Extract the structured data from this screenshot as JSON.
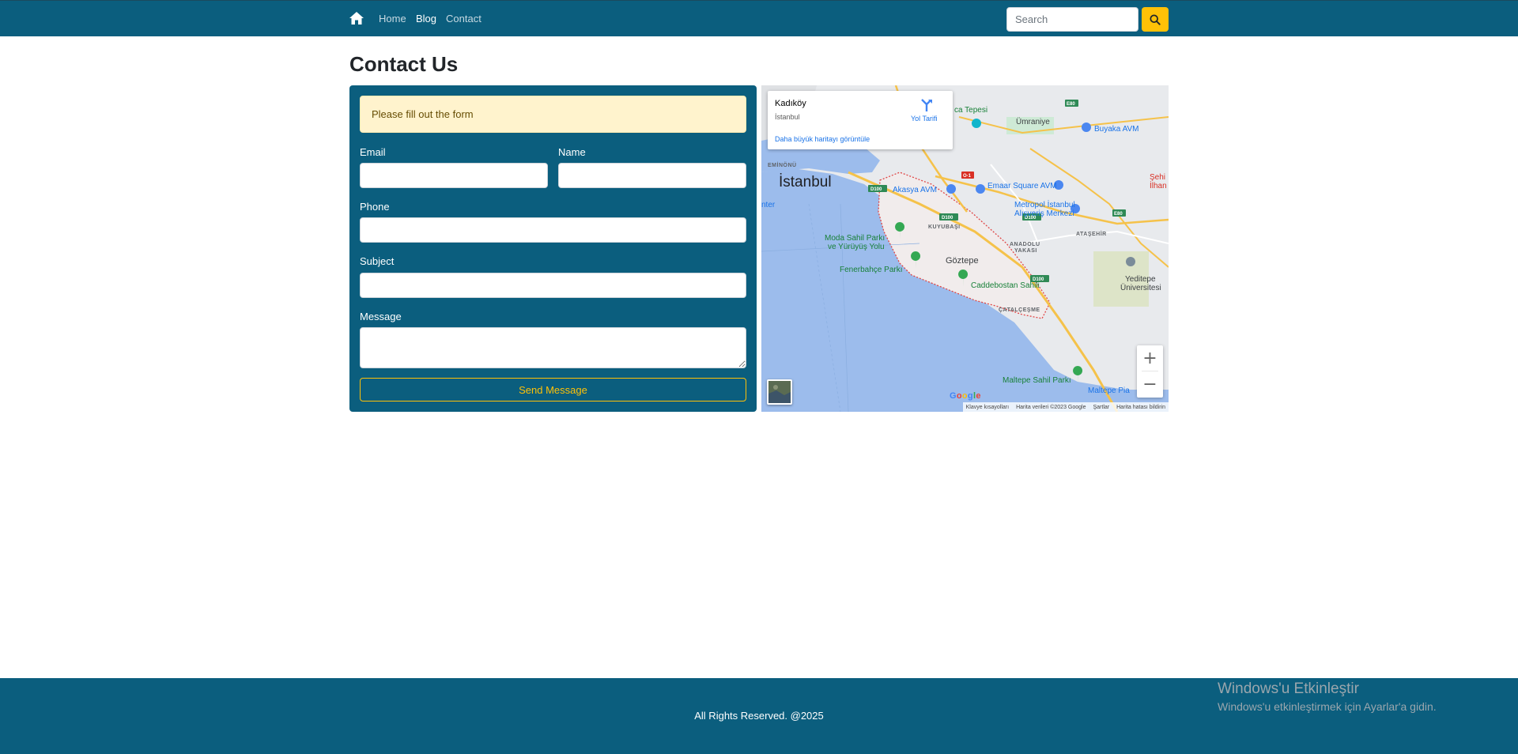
{
  "nav": {
    "links": [
      {
        "label": "Home"
      },
      {
        "label": "Blog"
      },
      {
        "label": "Contact"
      }
    ],
    "search_placeholder": "Search"
  },
  "page": {
    "title": "Contact Us"
  },
  "form": {
    "alert": "Please fill out the form",
    "email_label": "Email",
    "name_label": "Name",
    "phone_label": "Phone",
    "subject_label": "Subject",
    "message_label": "Message",
    "send_label": "Send Message"
  },
  "map": {
    "place_title": "Kadıköy",
    "place_subtitle": "İstanbul",
    "directions_label": "Yol Tarifi",
    "larger_map_link": "Daha büyük haritayı görüntüle",
    "labels": {
      "istanbul": "İstanbul",
      "goztepe": "Göztepe",
      "umraniye": "Ümraniye",
      "buyaka": "Buyaka AVM",
      "akasya": "Akasya AVM",
      "emaar": "Emaar Square AVM",
      "metropol_1": "Metropol İstanbul",
      "metropol_2": "Alışveriş Merkezi",
      "moda_1": "Moda Sahil Parkı",
      "moda_2": "ve Yürüyüş Yolu",
      "fenerbahce": "Fenerbahçe Parkı",
      "caddebostan": "Caddebostan Sahili",
      "yeditepe_1": "Yeditepe",
      "yeditepe_2": "Üniversitesi",
      "maltepe_sahil": "Maltepe Sahil Parkı",
      "maltepe_pia": "Maltepe Pia",
      "camlica": "ca Tepesi",
      "sehir_1": "Şehi",
      "sehir_2": "İlhan",
      "eminonu": "EMİNÖNÜ",
      "kuyubasi": "KUYUBAŞI",
      "atasehir": "ATAŞEHİR",
      "anadolu_1": "ANADOLU",
      "anadolu_2": "YAKASI",
      "catalcesme": "ÇATALÇEŞME",
      "nter": "nter"
    },
    "attribution": [
      "Klavye kısayolları",
      "Harita verileri ©2023 Google",
      "Şartlar",
      "Harita hatası bildirin"
    ],
    "google": "Google",
    "zoom_in": "+",
    "zoom_out": "−"
  },
  "footer": {
    "text": "All Rights Reserved. @2025"
  },
  "windows_watermark": {
    "title": "Windows'u Etkinleştir",
    "subtitle": "Windows'u etkinleştirmek için Ayarlar'a gidin."
  }
}
